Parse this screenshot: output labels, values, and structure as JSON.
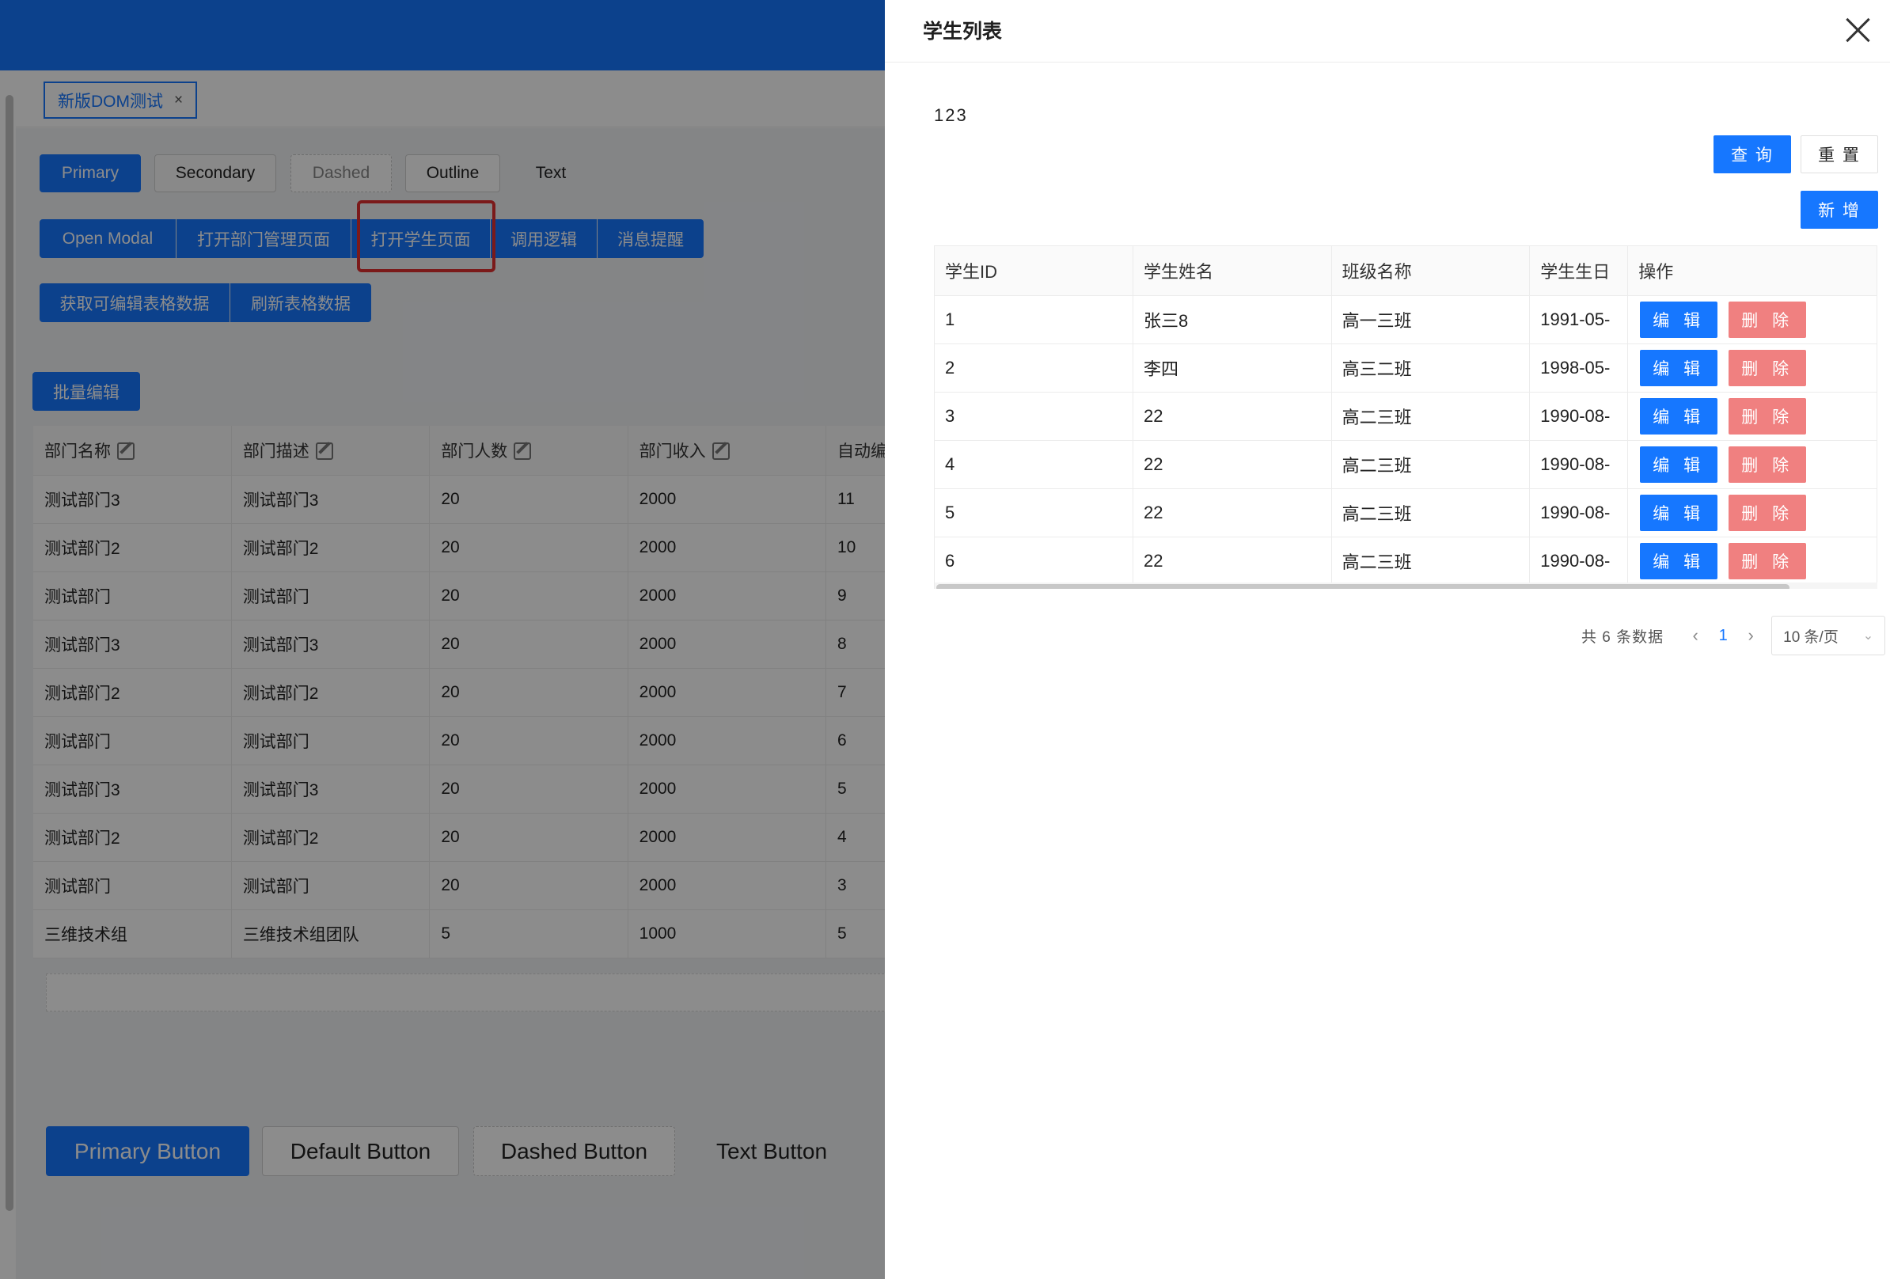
{
  "app": {
    "tab_label": "新版DOM测试",
    "tab_close": "×",
    "button_row1": [
      "Primary",
      "Secondary",
      "Dashed",
      "Outline",
      "Text"
    ],
    "button_row2": [
      "Open Modal",
      "打开部门管理页面",
      "打开学生页面",
      "调用逻辑",
      "消息提醒"
    ],
    "button_row3": [
      "获取可编辑表格数据",
      "刷新表格数据"
    ],
    "batch_edit": "批量编辑",
    "dept_table": {
      "headers": [
        "部门名称",
        "部门描述",
        "部门人数",
        "部门收入",
        "自动编"
      ],
      "rows": [
        [
          "测试部门3",
          "测试部门3",
          "20",
          "2000",
          "11"
        ],
        [
          "测试部门2",
          "测试部门2",
          "20",
          "2000",
          "10"
        ],
        [
          "测试部门",
          "测试部门",
          "20",
          "2000",
          "9"
        ],
        [
          "测试部门3",
          "测试部门3",
          "20",
          "2000",
          "8"
        ],
        [
          "测试部门2",
          "测试部门2",
          "20",
          "2000",
          "7"
        ],
        [
          "测试部门",
          "测试部门",
          "20",
          "2000",
          "6"
        ],
        [
          "测试部门3",
          "测试部门3",
          "20",
          "2000",
          "5"
        ],
        [
          "测试部门2",
          "测试部门2",
          "20",
          "2000",
          "4"
        ],
        [
          "测试部门",
          "测试部门",
          "20",
          "2000",
          "3"
        ],
        [
          "三维技术组",
          "三维技术组团队",
          "5",
          "1000",
          "5"
        ]
      ]
    },
    "bottom_buttons": [
      "Primary Button",
      "Default Button",
      "Dashed Button",
      "Text Button"
    ]
  },
  "drawer": {
    "title": "学生列表",
    "note": "123",
    "query": "查 询",
    "reset": "重 置",
    "add": "新 增",
    "table": {
      "headers": [
        "学生ID",
        "学生姓名",
        "班级名称",
        "学生生日",
        "操作"
      ],
      "rows": [
        [
          "1",
          "张三8",
          "高一三班",
          "1991-05-"
        ],
        [
          "2",
          "李四",
          "高三二班",
          "1998-05-"
        ],
        [
          "3",
          "22",
          "高二三班",
          "1990-08-"
        ],
        [
          "4",
          "22",
          "高二三班",
          "1990-08-"
        ],
        [
          "5",
          "22",
          "高二三班",
          "1990-08-"
        ],
        [
          "6",
          "22",
          "高二三班",
          "1990-08-"
        ]
      ],
      "edit_label": "编 辑",
      "delete_label": "删 除"
    },
    "pagination": {
      "total": "共 6 条数据",
      "current": "1",
      "page_size": "10 条/页"
    }
  },
  "colors": {
    "primary": "#1677ff",
    "danger": "#f08080",
    "highlight": "#e03131"
  }
}
